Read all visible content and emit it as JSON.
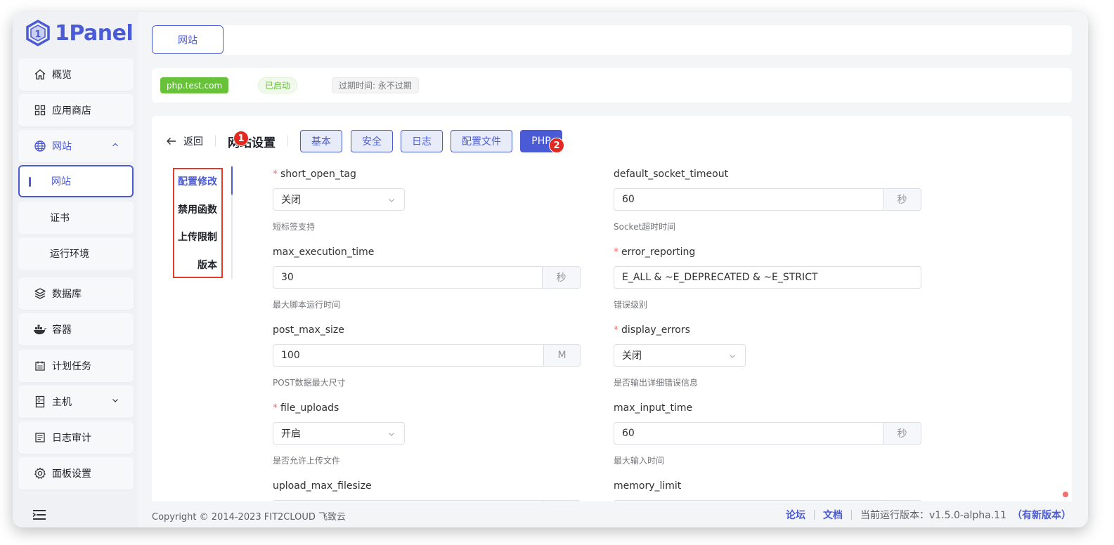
{
  "app": {
    "logo_text": "1Panel"
  },
  "sidebar": {
    "items": [
      {
        "label": "概览",
        "icon": "home-icon"
      },
      {
        "label": "应用商店",
        "icon": "grid-icon"
      },
      {
        "label": "网站",
        "icon": "globe-icon",
        "expanded": true
      },
      {
        "label": "数据库",
        "icon": "layers-icon"
      },
      {
        "label": "容器",
        "icon": "docker-icon"
      },
      {
        "label": "计划任务",
        "icon": "calendar-icon"
      },
      {
        "label": "主机",
        "icon": "server-icon"
      },
      {
        "label": "日志审计",
        "icon": "log-icon"
      },
      {
        "label": "面板设置",
        "icon": "gear-icon"
      }
    ],
    "website_sub": [
      {
        "label": "网站",
        "active": true
      },
      {
        "label": "证书"
      },
      {
        "label": "运行环境"
      }
    ]
  },
  "top_tab": {
    "label": "网站"
  },
  "site_info": {
    "domain": "php.test.com",
    "status": "已启动",
    "expire": "过期时间: 永不过期"
  },
  "settings": {
    "back_label": "返回",
    "title": "网站设置",
    "badge1": "1",
    "badge2": "2",
    "tabs": [
      "基本",
      "安全",
      "日志",
      "配置文件",
      "PHP"
    ],
    "active_tab": "PHP",
    "side_tabs": [
      "配置修改",
      "禁用函数",
      "上传限制",
      "版本"
    ],
    "active_side_tab": "配置修改"
  },
  "form": {
    "short_open_tag": {
      "label": "short_open_tag",
      "value": "关闭",
      "help": "短标签支持",
      "required": true
    },
    "default_socket_timeout": {
      "label": "default_socket_timeout",
      "value": "60",
      "unit": "秒",
      "help": "Socket超时时间"
    },
    "max_execution_time": {
      "label": "max_execution_time",
      "value": "30",
      "unit": "秒",
      "help": "最大脚本运行时间"
    },
    "error_reporting": {
      "label": "error_reporting",
      "value": "E_ALL & ~E_DEPRECATED & ~E_STRICT",
      "help": "错误级别",
      "required": true
    },
    "post_max_size": {
      "label": "post_max_size",
      "value": "100",
      "unit": "M",
      "help": "POST数据最大尺寸"
    },
    "display_errors": {
      "label": "display_errors",
      "value": "关闭",
      "help": "是否输出详细错误信息",
      "required": true
    },
    "file_uploads": {
      "label": "file_uploads",
      "value": "开启",
      "help": "是否允许上传文件",
      "required": true
    },
    "max_input_time": {
      "label": "max_input_time",
      "value": "60",
      "unit": "秒",
      "help": "最大输入时间"
    },
    "upload_max_filesize": {
      "label": "upload_max_filesize"
    },
    "memory_limit": {
      "label": "memory_limit"
    }
  },
  "footer": {
    "copyright": "Copyright © 2014-2023 FIT2CLOUD 飞致云",
    "forum": "论坛",
    "docs": "文档",
    "version": "当前运行版本：v1.5.0-alpha.11",
    "new_version": "（有新版本）"
  },
  "colors": {
    "accent": "#4b5bd6",
    "success": "#67c23a",
    "highlight": "#e53a2a",
    "badge": "#e3281f"
  }
}
